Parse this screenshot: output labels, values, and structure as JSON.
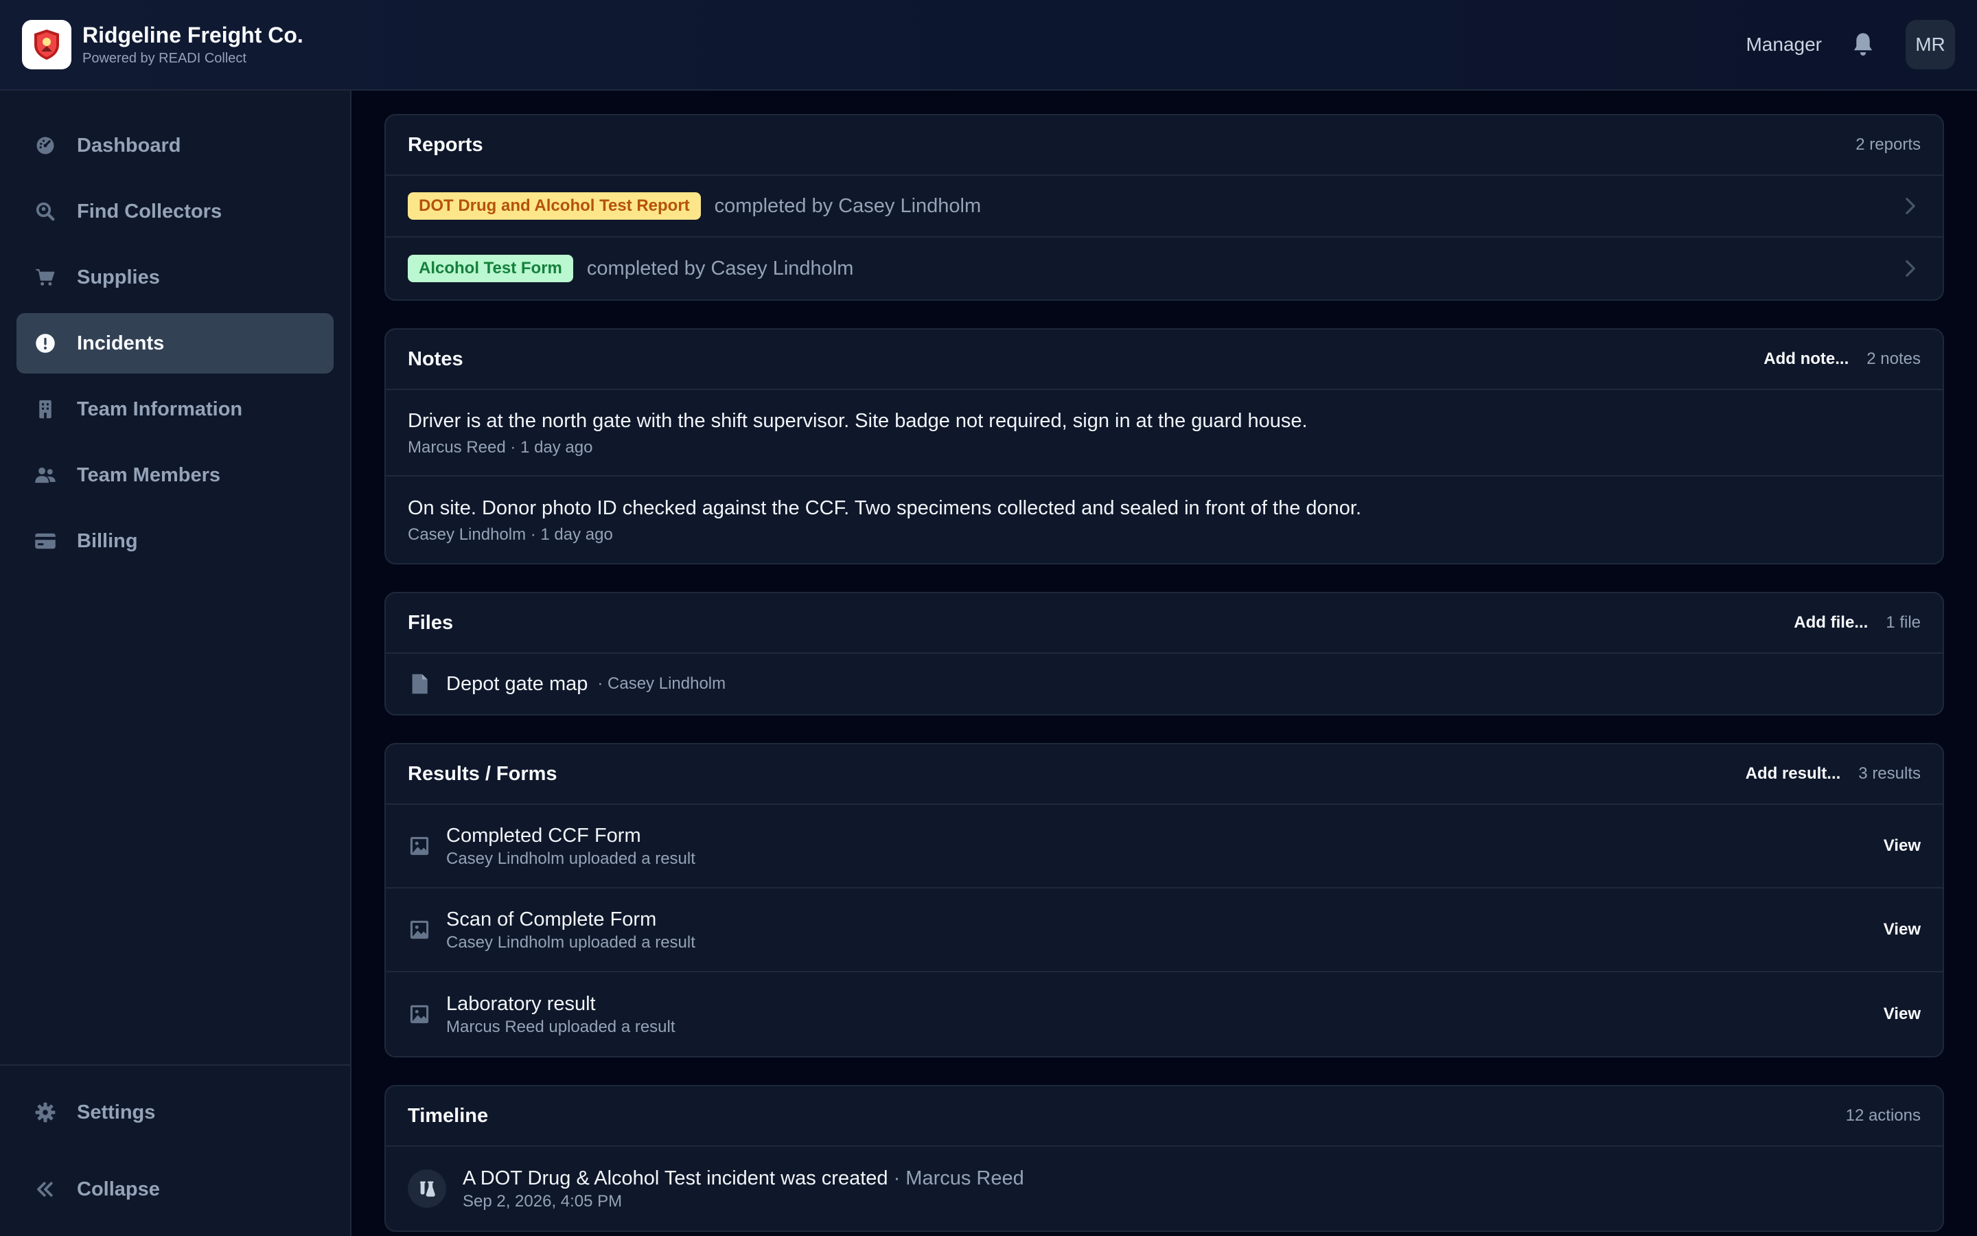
{
  "header": {
    "company": "Ridgeline Freight Co.",
    "powered_by": "Powered by READI Collect",
    "role": "Manager",
    "avatar_initials": "MR"
  },
  "sidebar": {
    "items": [
      {
        "label": "Dashboard",
        "icon": "dashboard-icon"
      },
      {
        "label": "Find Collectors",
        "icon": "search-location-icon"
      },
      {
        "label": "Supplies",
        "icon": "cart-icon"
      },
      {
        "label": "Incidents",
        "icon": "alert-circle-icon",
        "active": true
      },
      {
        "label": "Team Information",
        "icon": "building-icon"
      },
      {
        "label": "Team Members",
        "icon": "users-icon"
      },
      {
        "label": "Billing",
        "icon": "credit-card-icon"
      }
    ],
    "settings_label": "Settings",
    "collapse_label": "Collapse"
  },
  "reports": {
    "title": "Reports",
    "count": "2 reports",
    "items": [
      {
        "badge": "DOT Drug and Alcohol Test Report",
        "text": "completed by Casey Lindholm"
      },
      {
        "badge": "Alcohol Test Form",
        "text": "completed by Casey Lindholm"
      }
    ]
  },
  "notes": {
    "title": "Notes",
    "add_label": "Add note...",
    "count": "2 notes",
    "items": [
      {
        "text": "Driver is at the north gate with the shift supervisor. Site badge not required, sign in at the guard house.",
        "meta": "Marcus Reed · 1 day ago"
      },
      {
        "text": "On site. Donor photo ID checked against the CCF. Two specimens collected and sealed in front of the donor.",
        "meta": "Casey Lindholm · 1 day ago"
      }
    ]
  },
  "files": {
    "title": "Files",
    "add_label": "Add file...",
    "count": "1 file",
    "items": [
      {
        "name": "Depot gate map",
        "by": "· Casey Lindholm"
      }
    ]
  },
  "results": {
    "title": "Results / Forms",
    "add_label": "Add result...",
    "count": "3 results",
    "view_label": "View",
    "items": [
      {
        "title": "Completed CCF Form",
        "sub": "Casey Lindholm uploaded a result"
      },
      {
        "title": "Scan of Complete Form",
        "sub": "Casey Lindholm uploaded a result"
      },
      {
        "title": "Laboratory result",
        "sub": "Marcus Reed uploaded a result"
      }
    ]
  },
  "timeline": {
    "title": "Timeline",
    "count": "12 actions",
    "items": [
      {
        "title": "A DOT Drug & Alcohol Test incident was created",
        "by": " · Marcus Reed",
        "date": "Sep 2, 2026, 4:05 PM"
      }
    ]
  },
  "colors": {
    "background": "#020617",
    "panel": "#0f172a",
    "border": "#1e293b",
    "active_nav": "#334155",
    "badge_yellow_bg": "#fde68a",
    "badge_yellow_text": "#b45309",
    "badge_green_bg": "#bbf7d0",
    "badge_green_text": "#15803d"
  }
}
